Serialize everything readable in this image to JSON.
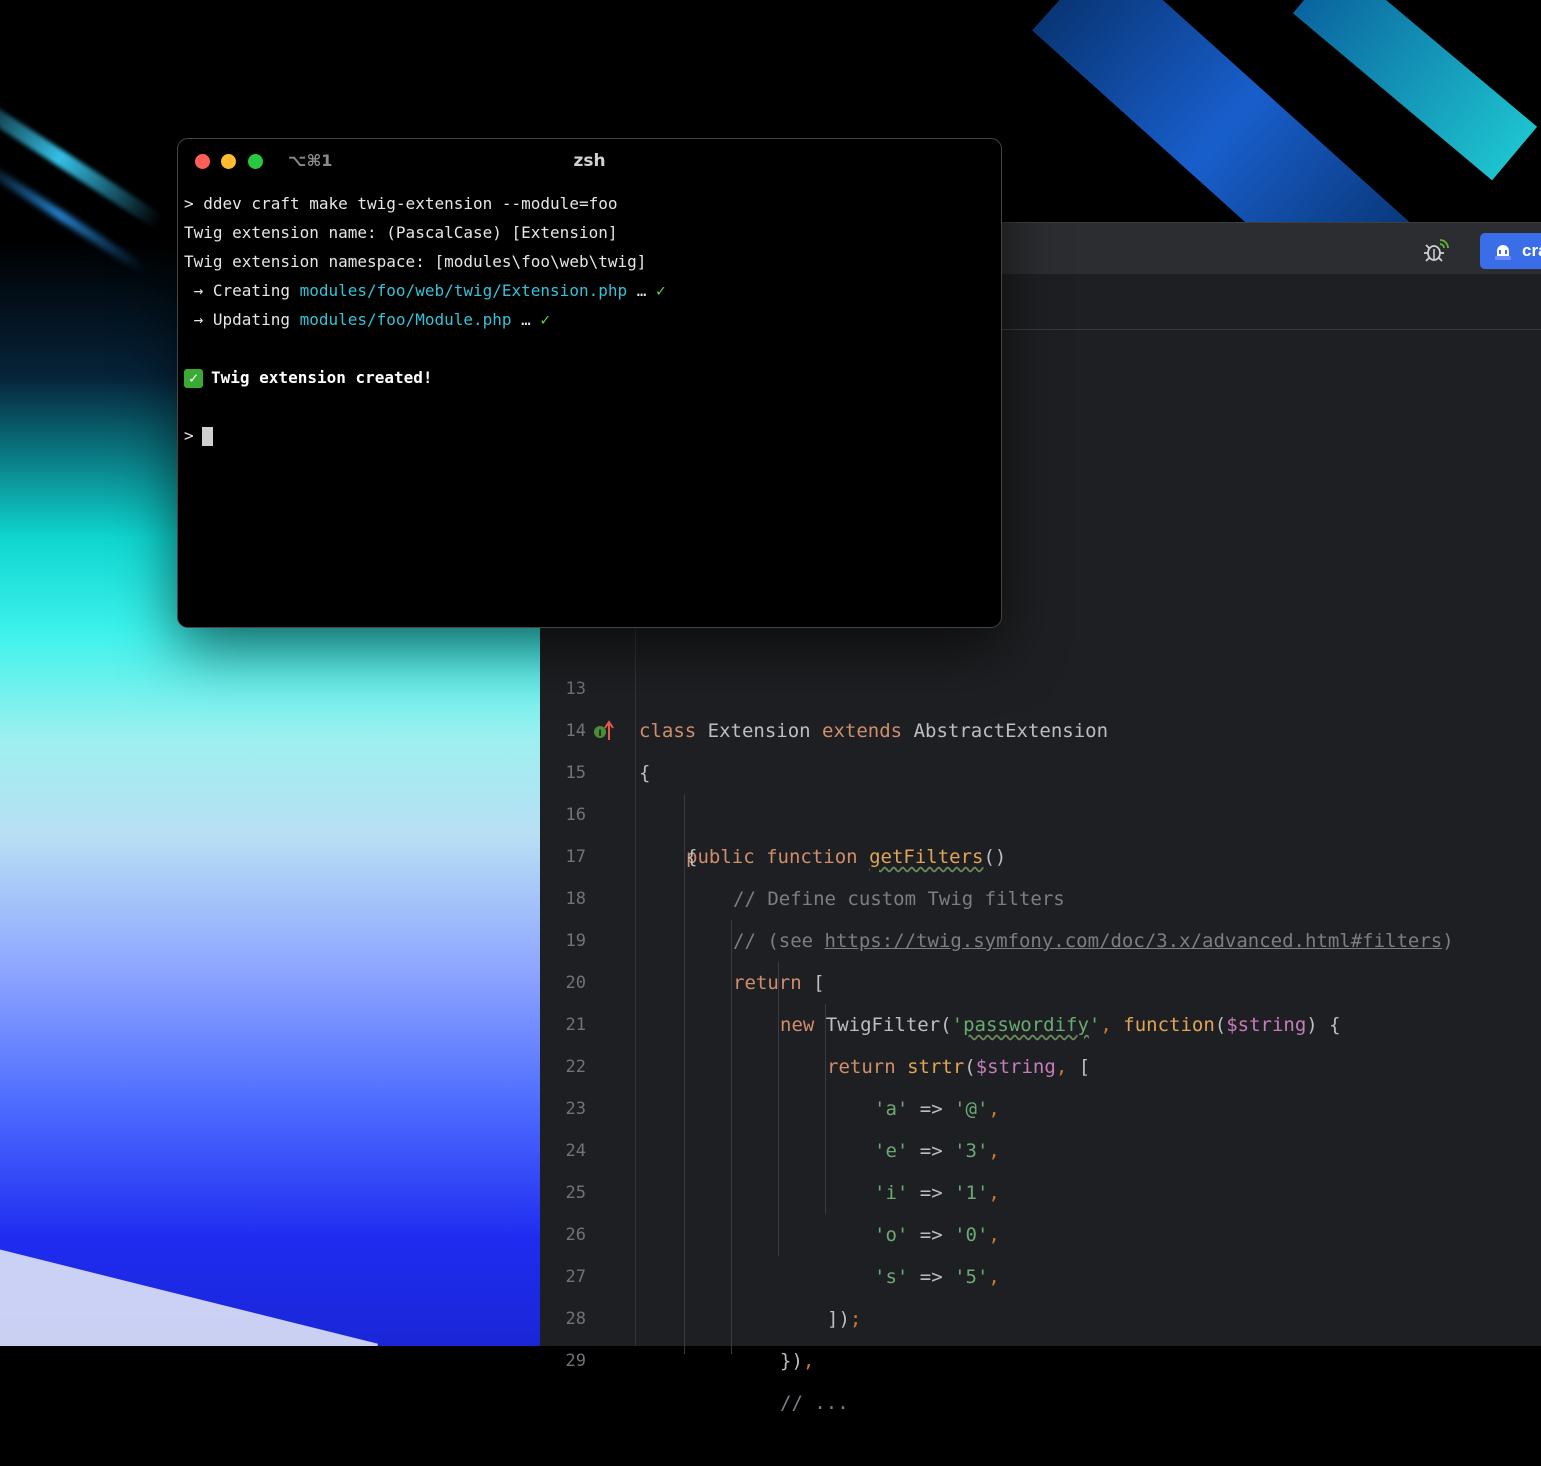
{
  "terminal": {
    "shortcut": "⌥⌘1",
    "title": "zsh",
    "lines": {
      "l1": "> ddev craft make twig-extension --module=foo",
      "l2": "Twig extension name: (PascalCase) [Extension]",
      "l3": "Twig extension namespace: [modules\\foo\\web\\twig]",
      "l4_prefix": " → Creating ",
      "l4_path": "modules/foo/web/twig/Extension.php",
      "l4_suffix": " … ",
      "l4_check": "✓",
      "l5_prefix": " → Updating ",
      "l5_path": "modules/foo/Module.php",
      "l5_suffix": " … ",
      "l5_check": "✓",
      "success_icon": "✓",
      "success": "Twig extension created!",
      "prompt": ">"
    }
  },
  "ide": {
    "run_button_label": "cra",
    "icons": {
      "debug": "debug-icon",
      "run": "craft-run-icon",
      "override": "override-method-icon"
    },
    "colors": {
      "keyword": "#cf8e6d",
      "function": "#e0a656",
      "string": "#6aab73",
      "variable": "#c77dbb",
      "comment": "#7a7e85"
    },
    "line_numbers": [
      "13",
      "14",
      "15",
      "16",
      "17",
      "18",
      "19",
      "20",
      "21",
      "22",
      "23",
      "24",
      "25",
      "26",
      "27",
      "28",
      "29"
    ],
    "code": {
      "l13_kw1": "class",
      "l13_name": " Extension ",
      "l13_kw2": "extends",
      "l13_parent": " AbstractExtension",
      "l14": "{",
      "l15_kw1": "public",
      "l15_kw2": "function",
      "l15_fn": "getFilters",
      "l15_rest": "()",
      "l16": "{",
      "l17": "// Define custom Twig filters",
      "l18_pre": "// (see ",
      "l18_link": "https://twig.symfony.com/doc/3.x/advanced.html#filters",
      "l18_post": ")",
      "l19_kw": "return",
      "l19_rest": " [",
      "l20_kw": "new",
      "l20_cls": " TwigFilter(",
      "l20_q1": "'",
      "l20_str": "passwordify",
      "l20_q2": "'",
      "l20_comma": ", ",
      "l20_fn": "function",
      "l20_paren": "(",
      "l20_var": "$string",
      "l20_rest": ") {",
      "l21_kw": "return",
      "l21_fn": " strtr",
      "l21_paren": "(",
      "l21_var": "$string",
      "l21_comma": ",",
      "l21_rest": " [",
      "map": [
        {
          "k": "'a'",
          "v": "'@'"
        },
        {
          "k": "'e'",
          "v": "'3'"
        },
        {
          "k": "'i'",
          "v": "'1'"
        },
        {
          "k": "'o'",
          "v": "'0'"
        },
        {
          "k": "'s'",
          "v": "'5'"
        }
      ],
      "arrow": " => ",
      "map_comma": ",",
      "l27": "])",
      "l27_semi": ";",
      "l28": "})",
      "l28_comma": ",",
      "l29": "// ..."
    }
  }
}
